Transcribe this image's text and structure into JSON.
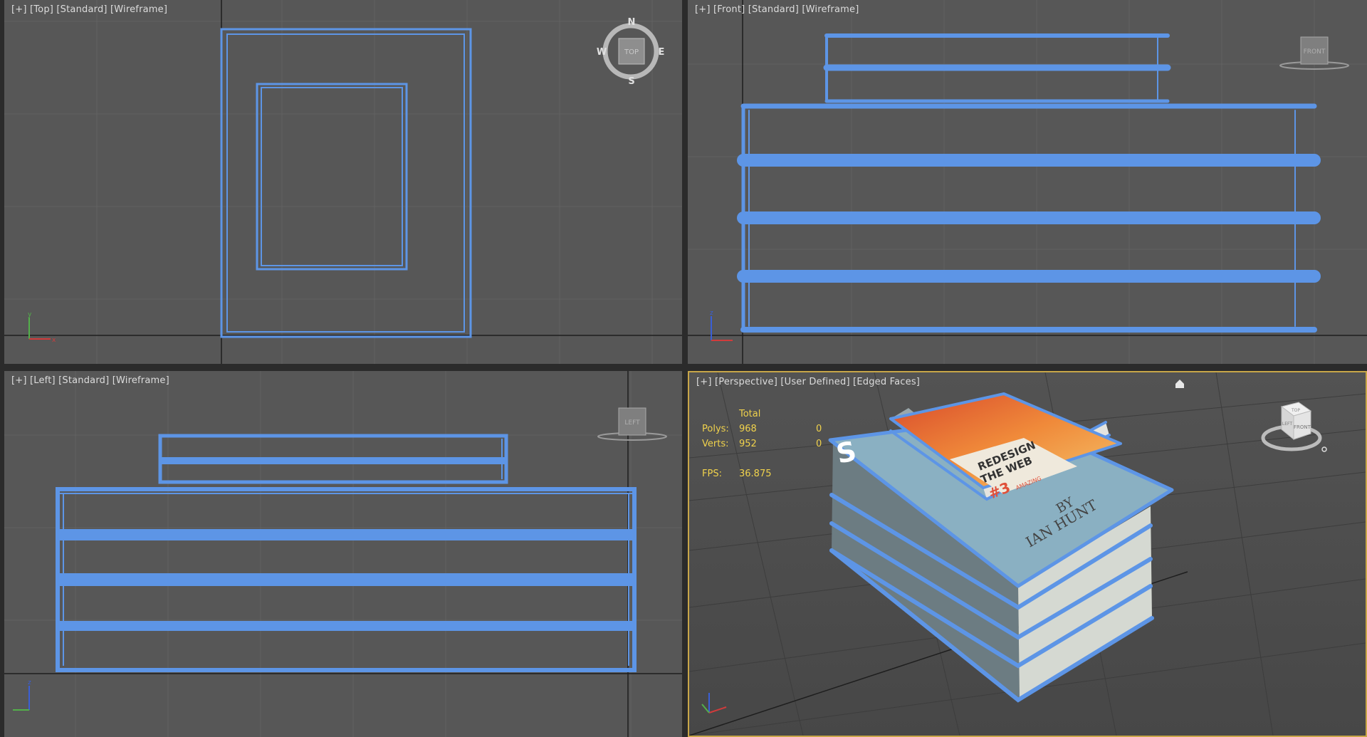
{
  "viewports": {
    "top": {
      "label": "[+] [Top] [Standard] [Wireframe]",
      "gizmo": {
        "label": "TOP",
        "n": "N",
        "s": "S",
        "e": "E",
        "w": "W"
      }
    },
    "front": {
      "label": "[+] [Front] [Standard] [Wireframe]",
      "gizmo": {
        "label": "FRONT"
      }
    },
    "left": {
      "label": "[+] [Left] [Standard] [Wireframe]",
      "gizmo": {
        "label": "LEFT"
      }
    },
    "perspective": {
      "label": "[+] [Perspective] [User Defined] [Edged Faces]",
      "stats": {
        "total_header": "Total",
        "polys_label": "Polys:",
        "polys_value": "968",
        "polys_selected": "0",
        "verts_label": "Verts:",
        "verts_value": "952",
        "verts_selected": "0",
        "fps_label": "FPS:",
        "fps_value": "36.875"
      },
      "viewcube": {
        "top_label": "TOP",
        "front_label": "FRONT",
        "left_label": "LEFT"
      },
      "book_cover_text": {
        "title_line1": "REDESIGN",
        "title_line2": "THE WEB",
        "number": "#3",
        "subtitle": "AMAZING",
        "by": "BY",
        "author": "IAN HUNT",
        "cover_letter": "S"
      }
    }
  },
  "colors": {
    "viewport_bg": "#575757",
    "grid": "#626262",
    "wire": "#5d95e6",
    "active_border": "#c8a648",
    "stats_text": "#f0d24c"
  }
}
